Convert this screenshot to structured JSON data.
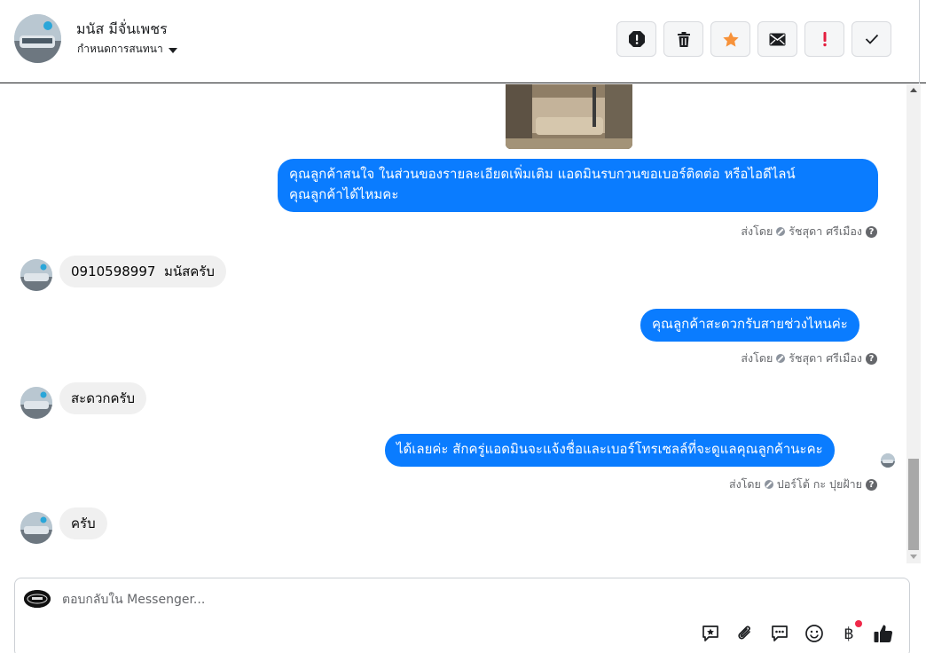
{
  "header": {
    "contact_name": "มนัส มีจั่นเพชร",
    "assign_label": "กำหนดการสนทนา",
    "actions": [
      {
        "name": "report-spam-button",
        "icon": "alert-circle-icon"
      },
      {
        "name": "delete-button",
        "icon": "trash-icon"
      },
      {
        "name": "star-button",
        "icon": "star-icon"
      },
      {
        "name": "mark-unread-button",
        "icon": "envelope-icon"
      },
      {
        "name": "follow-up-button",
        "icon": "exclamation-icon"
      },
      {
        "name": "mark-done-button",
        "icon": "check-icon"
      }
    ]
  },
  "messages": [
    {
      "dir": "out",
      "text_line1": "คุณลูกค้าสนใจ ในส่วนของรายละเอียดเพิ่มเติม แอดมินรบกวนขอเบอร์ติดต่อ หรือไอดีไลน์",
      "text_line2": "คุณลูกค้าได้ไหมคะ"
    },
    {
      "dir": "out_meta",
      "label": "ส่งโดย",
      "agent": "รัชสุดา ศรีเมือง"
    },
    {
      "dir": "in",
      "text": "0910598997  มนัสครับ"
    },
    {
      "dir": "out",
      "text": "คุณลูกค้าสะดวกรับสายช่วงไหนค่ะ"
    },
    {
      "dir": "out_meta",
      "label": "ส่งโดย",
      "agent": "รัชสุดา ศรีเมือง"
    },
    {
      "dir": "in",
      "text": "สะดวกครับ"
    },
    {
      "dir": "out",
      "text": "ได้เลยค่ะ สักครู่แอดมินจะแจ้งชื่อและเบอร์โทรเซลล์ที่จะดูแลคุณลูกค้านะคะ"
    },
    {
      "dir": "out_meta",
      "label": "ส่งโดย",
      "agent": "ปอร์โต้ กะ ปุยฝ้าย"
    },
    {
      "dir": "in",
      "text": "ครับ"
    }
  ],
  "composer": {
    "placeholder": "ตอบกลับใน Messenger...",
    "value": "",
    "tools": [
      "saved-reply-icon",
      "attachment-icon",
      "chat-bubbles-icon",
      "emoji-icon",
      "baht-payment-icon",
      "thumbs-up-icon"
    ],
    "baht_symbol": "฿"
  },
  "colors": {
    "outgoing_bubble": "#0a7cff",
    "incoming_bubble": "#f0f0f0",
    "star": "#f7923a",
    "follow_up": "#e41e3f",
    "notification_dot": "#f02849"
  }
}
